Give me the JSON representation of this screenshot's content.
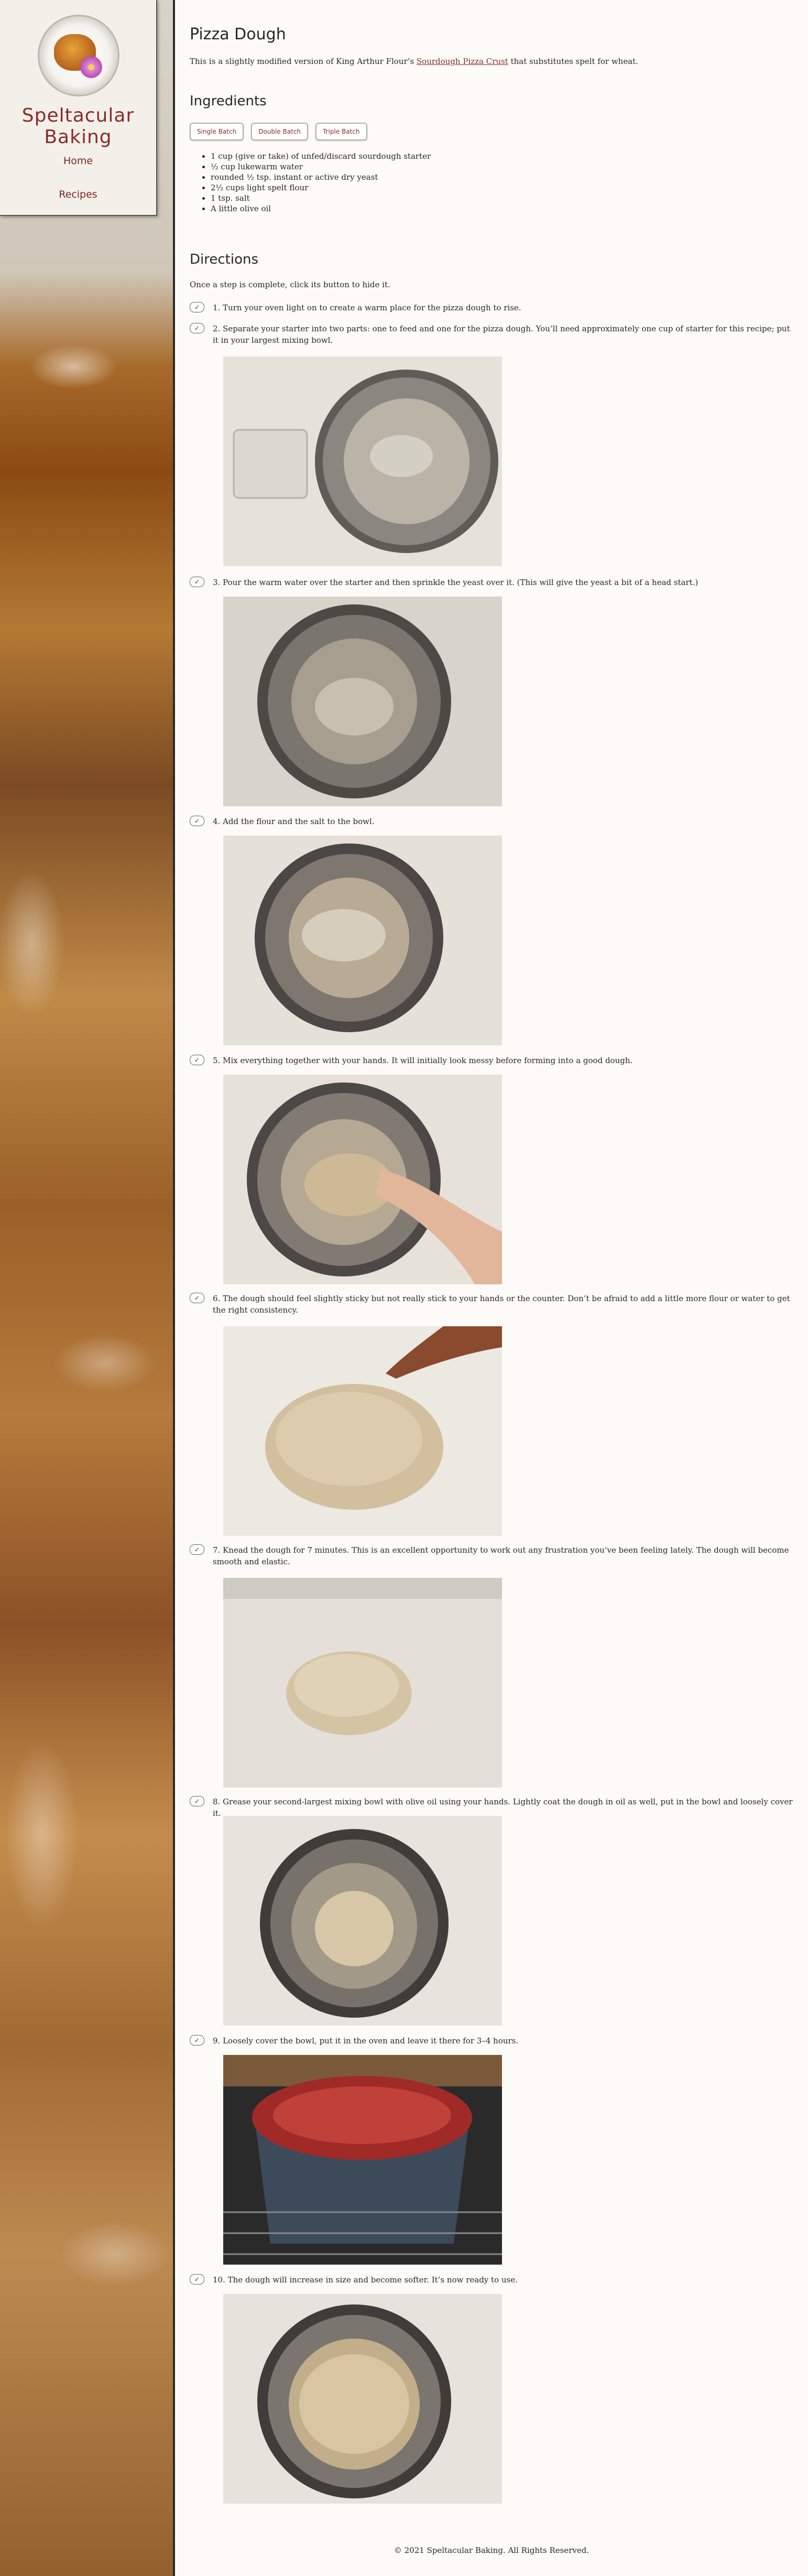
{
  "site": {
    "title": "Speltacular Baking",
    "logo_icon": "bundt-cake-with-flower-icon"
  },
  "nav": {
    "items": [
      {
        "label": "Home"
      },
      {
        "label": "Recipes"
      }
    ]
  },
  "page": {
    "title": "Pizza Dough",
    "intro_before": "This is a slightly modified version of King Arthur Flour’s ",
    "intro_link": "Sourdough Pizza Crust",
    "intro_after": " that substitutes spelt for wheat."
  },
  "ingredients": {
    "heading": "Ingredients",
    "batch_buttons": [
      "Single Batch",
      "Double Batch",
      "Triple Batch"
    ],
    "items": [
      "1 cup (give or take) of unfed/discard sourdough starter",
      "½ cup lukewarm water",
      "rounded ½ tsp. instant or active dry yeast",
      "2½ cups light spelt flour",
      "1 tsp. salt",
      "A little olive oil"
    ]
  },
  "directions": {
    "heading": "Directions",
    "note": "Once a step is complete, click its button to hide it.",
    "check_icon": "checkmark-icon",
    "steps": [
      {
        "text": "1. Turn your oven light on to create a warm place for the pizza dough to rise."
      },
      {
        "text": "2. Separate your starter into two parts: one to feed and one for the pizza dough. You’ll need approximately one cup of starter for this recipe; put it in your largest mixing bowl."
      },
      {
        "text": "3. Pour the warm water over the starter and then sprinkle the yeast over it. (This will give the yeast a bit of a head start.)"
      },
      {
        "text": "4. Add the flour and the salt to the bowl."
      },
      {
        "text": "5. Mix everything together with your hands. It will initially look messy before forming into a good dough."
      },
      {
        "text": "6. The dough should feel slightly sticky but not really stick to your hands or the counter. Don’t be afraid to add a little more flour or water to get the right consistency."
      },
      {
        "text": "7. Knead the dough for 7 minutes. This is an excellent opportunity to work out any frustration you’ve been feeling lately. The dough will become smooth and elastic."
      },
      {
        "text": "8. Grease your second-largest mixing bowl with olive oil using your hands. Lightly coat the dough in oil as well, put in the bowl and loosely cover it."
      },
      {
        "text": "9. Loosely cover the bowl, put it in the oven and leave it there for 3–4 hours."
      },
      {
        "text": "10. The dough will increase in size and become softer. It’s now ready to use."
      }
    ]
  },
  "footer": {
    "text": "© 2021 Speltacular Baking. All Rights Reserved."
  }
}
